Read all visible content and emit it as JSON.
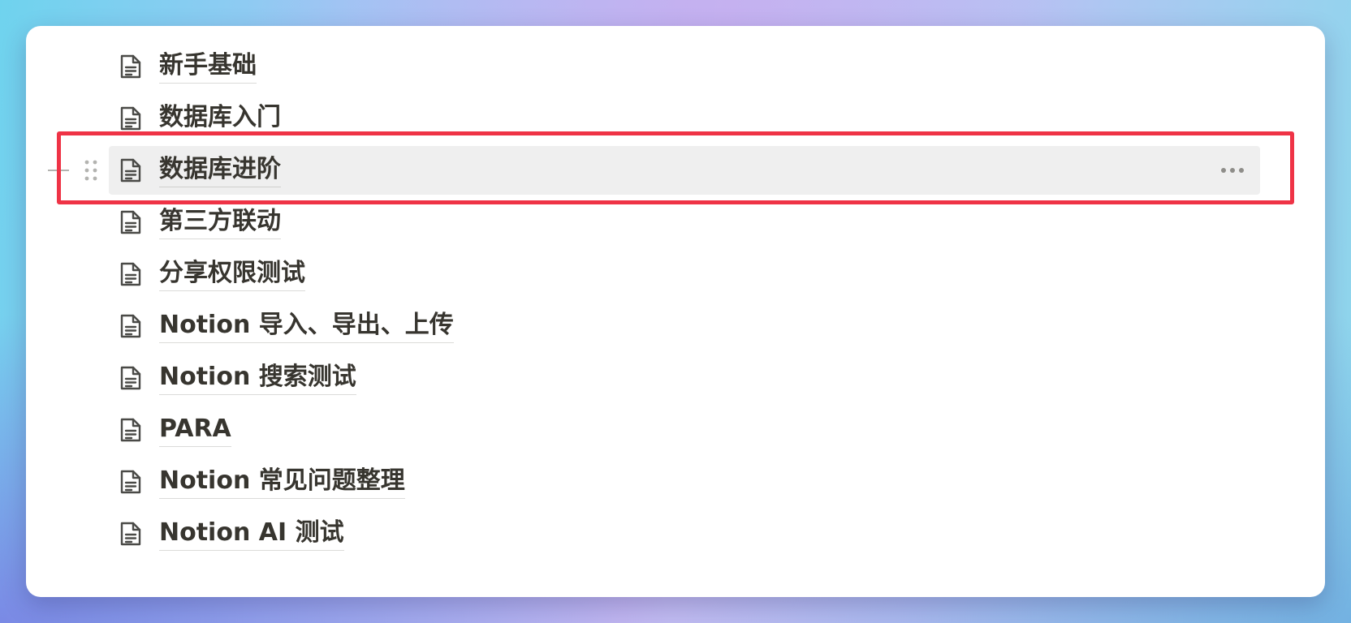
{
  "pages": [
    {
      "title": "新手基础",
      "icon": "document-icon"
    },
    {
      "title": "数据库入门",
      "icon": "document-icon"
    },
    {
      "title": "数据库进阶",
      "icon": "document-icon",
      "hovered": true
    },
    {
      "title": "第三方联动",
      "icon": "document-icon"
    },
    {
      "title": "分享权限测试",
      "icon": "document-icon"
    },
    {
      "title": "Notion 导入、导出、上传",
      "icon": "document-icon"
    },
    {
      "title": "Notion 搜索测试",
      "icon": "document-icon"
    },
    {
      "title": "PARA",
      "icon": "document-icon"
    },
    {
      "title": "Notion 常见问题整理",
      "icon": "document-icon"
    },
    {
      "title": "Notion AI 测试",
      "icon": "document-icon"
    }
  ],
  "hover_controls": {
    "add_icon": "plus-icon",
    "drag_icon": "drag-handle-icon",
    "more_icon": "more-horizontal-icon"
  },
  "colors": {
    "text": "#37352f",
    "icon": "#4a4a47",
    "hover_bg": "#efefef",
    "highlight": "#ef3346",
    "control_gray": "#b3b3b0"
  }
}
